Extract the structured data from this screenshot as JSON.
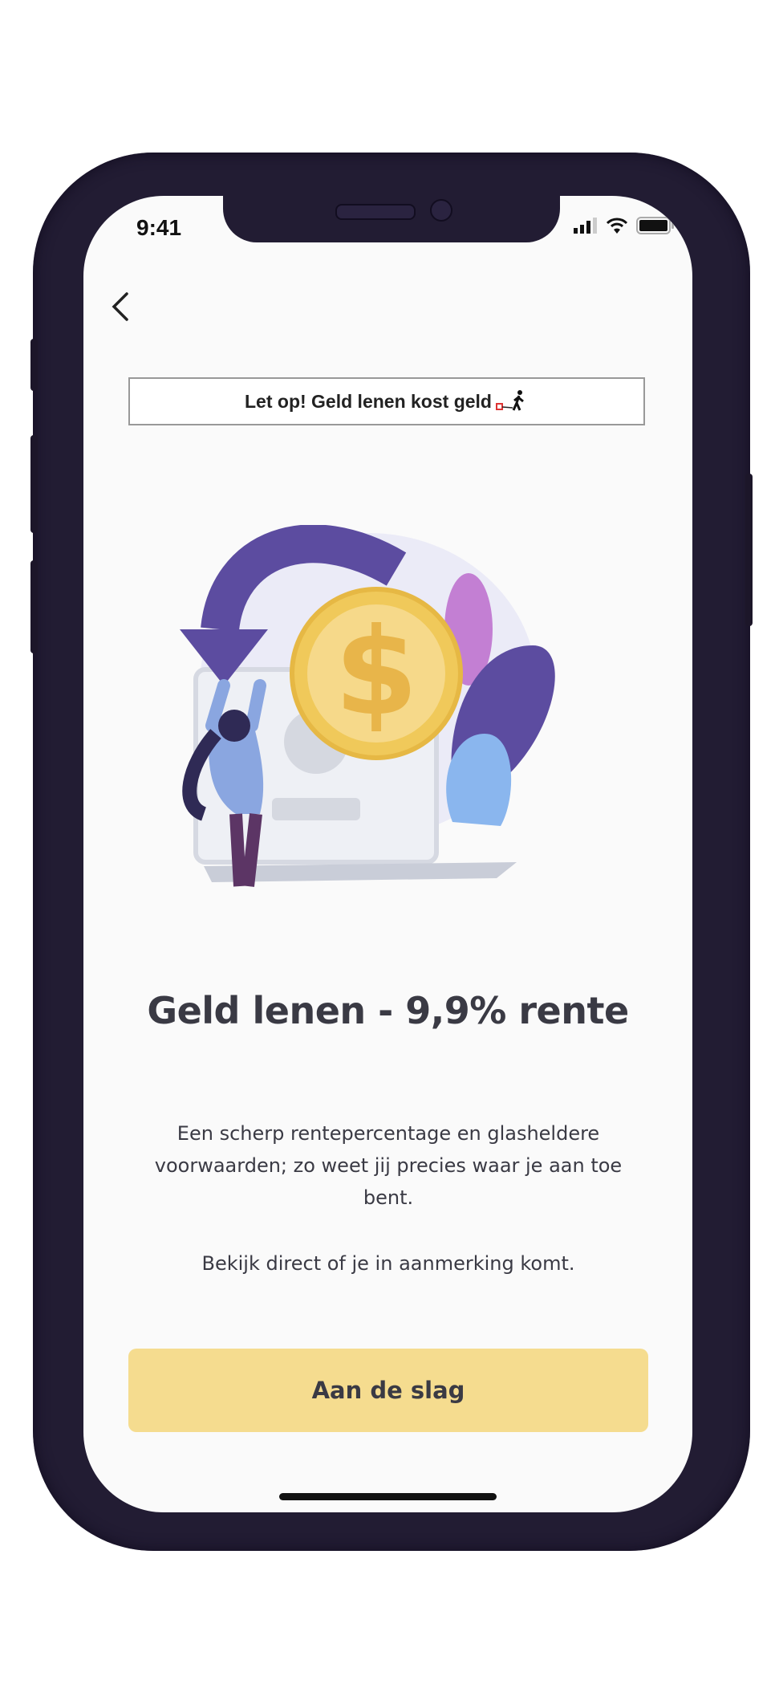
{
  "status_bar": {
    "time": "9:41"
  },
  "navigation": {
    "back_icon": "chevron-left-icon"
  },
  "banner": {
    "text": "Let op! Geld lenen kost geld",
    "icon": "walking-man-ball-chain-icon"
  },
  "hero": {
    "illustration": "woman-coin-laptop-illustration",
    "currency_symbol": "$"
  },
  "title": "Geld lenen - 9,9% rente",
  "description": {
    "paragraph1": "Een scherp rentepercentage en glasheldere voorwaarden; zo weet jij precies waar je aan toe bent.",
    "paragraph2": "Bekijk direct of je in aanmerking komt."
  },
  "cta": {
    "label": "Aan de slag",
    "color": "#f5dc8f"
  }
}
